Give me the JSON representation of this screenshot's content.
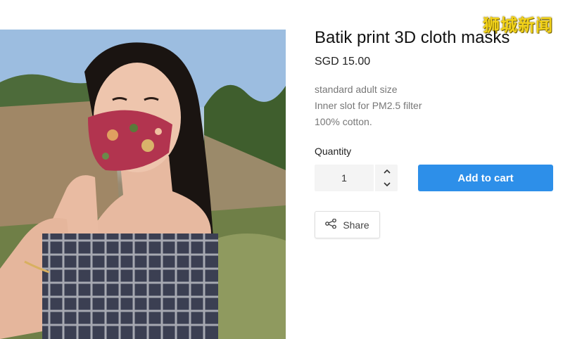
{
  "watermark": "狮城新闻",
  "product": {
    "title": "Batik print 3D cloth masks",
    "price": "SGD 15.00",
    "description": [
      "standard adult size",
      "Inner slot for PM2.5 filter",
      "100% cotton."
    ]
  },
  "quantity": {
    "label": "Quantity",
    "value": "1"
  },
  "actions": {
    "add_to_cart": "Add to cart",
    "share": "Share"
  },
  "icons": {
    "increment": "chevron-up-icon",
    "decrement": "chevron-down-icon",
    "share": "share-icon"
  },
  "colors": {
    "accent": "#2d8fe9",
    "watermark": "#f2d21a"
  }
}
